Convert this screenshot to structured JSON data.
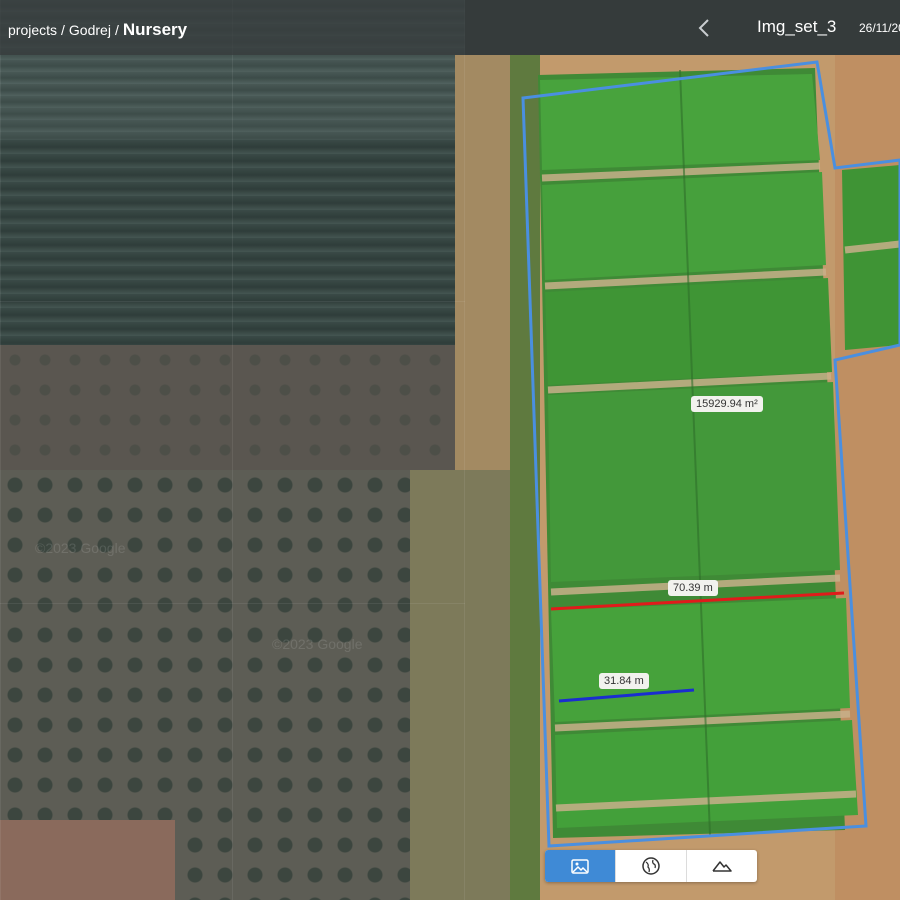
{
  "breadcrumb": {
    "root": "projects",
    "separator": "/",
    "project": "Godrej",
    "current": "Nursery"
  },
  "image_set": {
    "title": "Img_set_3",
    "date": "26/11/20"
  },
  "map": {
    "watermarks": [
      "©2023 Google",
      "©2023 Google"
    ],
    "area_label": "15929.94 m²",
    "distance_labels": [
      "70.39 m",
      "31.84 m"
    ]
  },
  "toolbar": {
    "items": [
      {
        "name": "image-view",
        "icon": "image-icon",
        "active": true
      },
      {
        "name": "map-view",
        "icon": "globe-icon",
        "active": false
      },
      {
        "name": "terrain-view",
        "icon": "mountain-icon",
        "active": false
      }
    ]
  },
  "colors": {
    "boundary": "#4a8fe0",
    "measure_long": "#e01b1b",
    "measure_short": "#1a2ed0",
    "active_tool": "#3f8ad6"
  }
}
